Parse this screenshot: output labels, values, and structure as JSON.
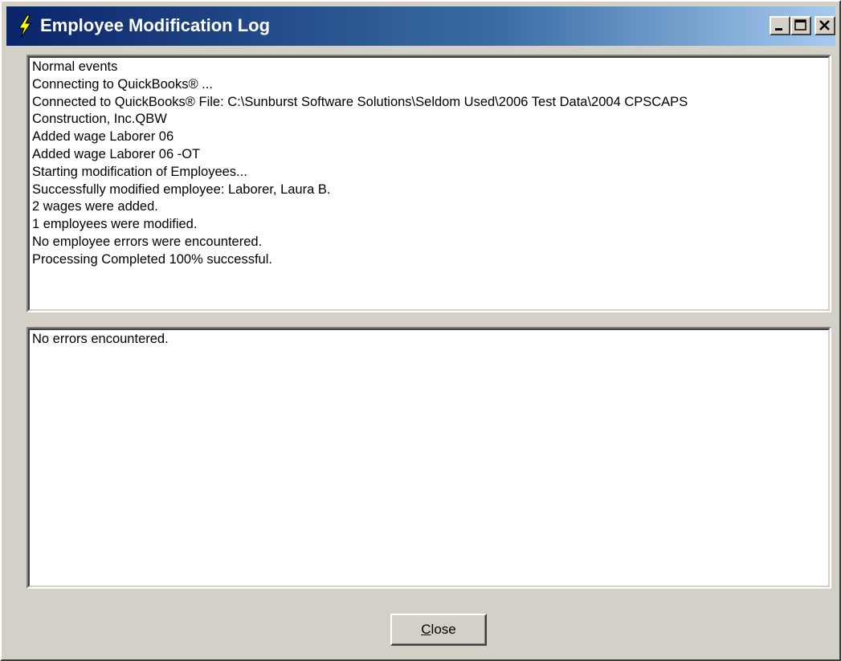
{
  "window": {
    "title": "Employee Modification Log",
    "colors": {
      "titlebar_start": "#0a246a",
      "titlebar_end": "#a6caf0",
      "face": "#d4d0c8"
    },
    "icons": [
      "lightning-icon",
      "minimize-icon",
      "maximize-icon",
      "close-icon"
    ]
  },
  "log": {
    "lines": [
      "Normal events",
      "Connecting to QuickBooks® ...",
      "Connected to QuickBooks® File: C:\\Sunburst Software Solutions\\Seldom Used\\2006 Test Data\\2004 CPSCAPS",
      "Construction, Inc.QBW",
      "Added wage Laborer 06",
      "Added wage Laborer 06 -OT",
      "Starting modification of Employees...",
      "Successfully modified employee: Laborer, Laura B.",
      "2 wages were added.",
      "1 employees were modified.",
      "No employee errors were encountered.",
      "Processing Completed 100% successful."
    ]
  },
  "errors": {
    "lines": [
      "No errors encountered."
    ]
  },
  "buttons": {
    "close_accel": "C",
    "close_rest": "lose"
  }
}
